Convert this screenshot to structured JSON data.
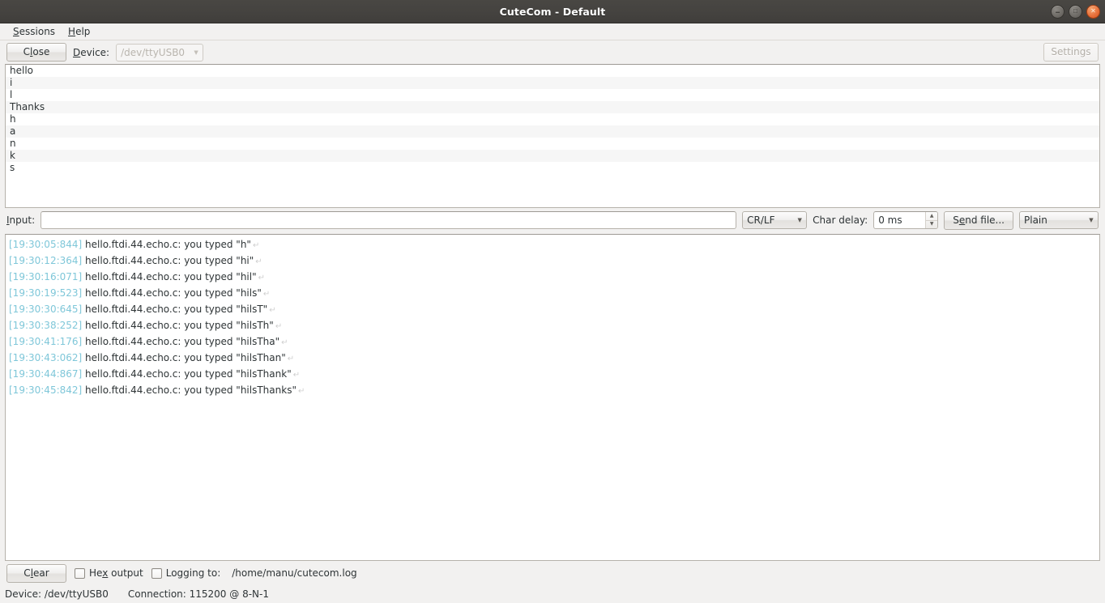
{
  "window": {
    "title": "CuteCom - Default",
    "controls": [
      {
        "name": "minimize",
        "glyph": "–"
      },
      {
        "name": "maximize",
        "glyph": "❐"
      },
      {
        "name": "close",
        "glyph": "✕"
      }
    ]
  },
  "menubar": {
    "items": [
      {
        "label": "Sessions",
        "mnemonic": "S"
      },
      {
        "label": "Help",
        "mnemonic": "H"
      }
    ]
  },
  "toolbar": {
    "close_label": "Close",
    "close_mnemonic": "C",
    "device_label": "Device:",
    "device_mnemonic": "D",
    "device_value": "/dev/ttyUSB0",
    "settings_label": "Settings",
    "settings_enabled": false
  },
  "history": {
    "rows": [
      "hello",
      "i",
      "l",
      "Thanks",
      "h",
      "a",
      "n",
      "k",
      "s"
    ]
  },
  "input_row": {
    "input_label": "Input:",
    "input_mnemonic": "I",
    "input_value": "",
    "input_placeholder": "",
    "linebreak_value": "CR/LF",
    "char_delay_label": "Char delay:",
    "char_delay_value": "0 ms",
    "send_file_label": "Send file...",
    "send_file_mnemonic": "e",
    "protocol_value": "Plain"
  },
  "log": {
    "lines": [
      {
        "ts": "[19:30:05:844]",
        "text": "hello.ftdi.44.echo.c: you typed \"h\"",
        "cr": "↵"
      },
      {
        "ts": "[19:30:12:364]",
        "text": "hello.ftdi.44.echo.c: you typed \"hi\"",
        "cr": "↵"
      },
      {
        "ts": "[19:30:16:071]",
        "text": "hello.ftdi.44.echo.c: you typed \"hil\"",
        "cr": "↵"
      },
      {
        "ts": "[19:30:19:523]",
        "text": "hello.ftdi.44.echo.c: you typed \"hils\"",
        "cr": "↵"
      },
      {
        "ts": "[19:30:30:645]",
        "text": "hello.ftdi.44.echo.c: you typed \"hilsT\"",
        "cr": "↵"
      },
      {
        "ts": "[19:30:38:252]",
        "text": "hello.ftdi.44.echo.c: you typed \"hilsTh\"",
        "cr": "↵"
      },
      {
        "ts": "[19:30:41:176]",
        "text": "hello.ftdi.44.echo.c: you typed \"hilsTha\"",
        "cr": "↵"
      },
      {
        "ts": "[19:30:43:062]",
        "text": "hello.ftdi.44.echo.c: you typed \"hilsThan\"",
        "cr": "↵"
      },
      {
        "ts": "[19:30:44:867]",
        "text": "hello.ftdi.44.echo.c: you typed \"hilsThank\"",
        "cr": "↵"
      },
      {
        "ts": "[19:30:45:842]",
        "text": "hello.ftdi.44.echo.c: you typed \"hilsThanks\"",
        "cr": "↵"
      }
    ]
  },
  "bottombar": {
    "clear_label": "Clear",
    "clear_mnemonic": "l",
    "hex_output_label": "Hex output",
    "hex_output_checked": false,
    "logging_to_label": "Logging to:",
    "logging_to_checked": false,
    "log_path": "/home/manu/cutecom.log"
  },
  "statusbar": {
    "device_text": "Device: /dev/ttyUSB0",
    "connection_text": "Connection: 115200 @ 8-N-1"
  },
  "colors": {
    "titlebar": "#454340",
    "timestamp": "#7fc7d9",
    "close_button": "#e8713c",
    "background": "#f2f1f0"
  }
}
